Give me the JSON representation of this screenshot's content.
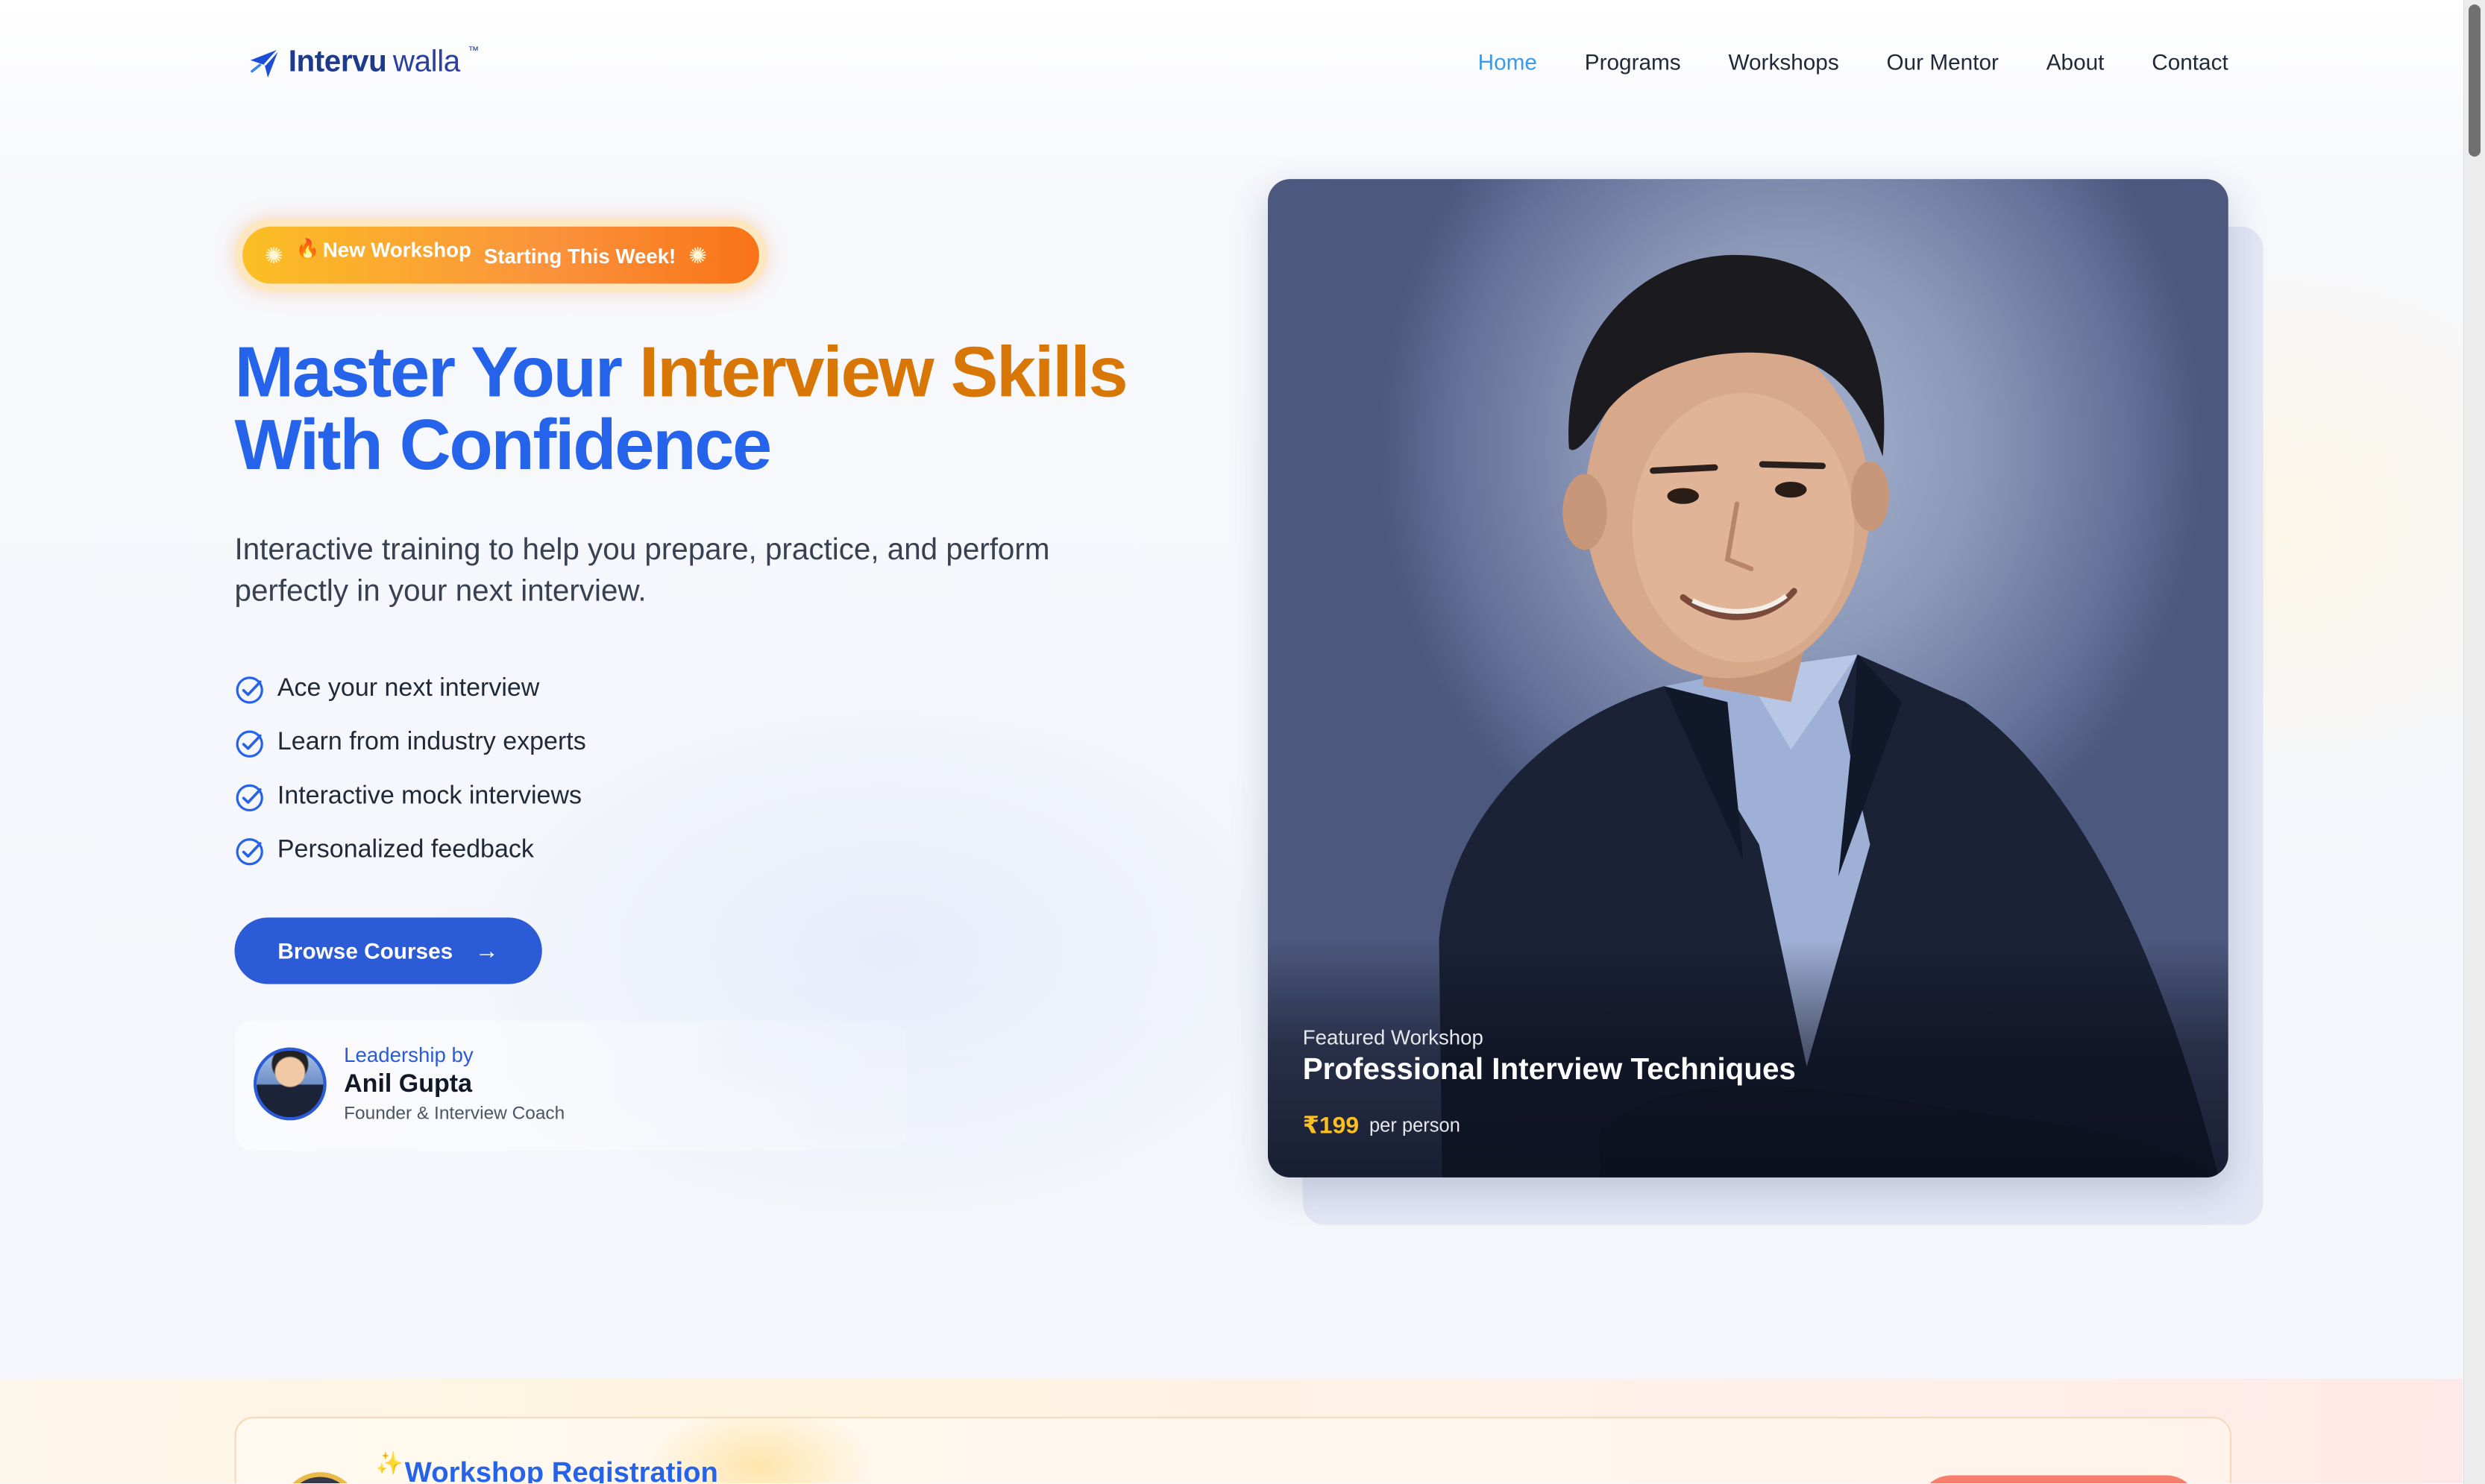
{
  "brand": {
    "name_bold": "Intervu",
    "name_light": "walla",
    "trademark": "™",
    "accent_color": "#2563eb",
    "highlight_color": "#d97706"
  },
  "nav": {
    "items": [
      {
        "label": "Home",
        "active": true
      },
      {
        "label": "Programs",
        "active": false
      },
      {
        "label": "Workshops",
        "active": false
      },
      {
        "label": "Our Mentor",
        "active": false
      },
      {
        "label": "About",
        "active": false
      },
      {
        "label": "Contact",
        "active": false
      }
    ]
  },
  "hero": {
    "badge": {
      "fire_icon": "🔥",
      "part_a": "New Workshop",
      "part_b": "Starting This Week!",
      "sparkle_icon": "✺"
    },
    "title_line1_plain": "Master Your ",
    "title_line1_highlight": "Interview Skills",
    "title_line2": "With Confidence",
    "subtitle": "Interactive training to help you prepare, practice, and perform perfectly in your next interview.",
    "features": [
      "Ace your next interview",
      "Learn from industry experts",
      "Interactive mock interviews",
      "Personalized feedback"
    ],
    "cta_label": "Browse Courses",
    "cta_arrow": "→",
    "leader": {
      "kicker": "Leadership by",
      "name": "Anil Gupta",
      "role": "Founder & Interview Coach"
    }
  },
  "featured": {
    "kicker": "Featured Workshop",
    "title": "Professional Interview Techniques",
    "price": "₹199",
    "price_unit": "per person"
  },
  "registration": {
    "title": "Workshop Registration",
    "sparkle_icon": "✨"
  }
}
